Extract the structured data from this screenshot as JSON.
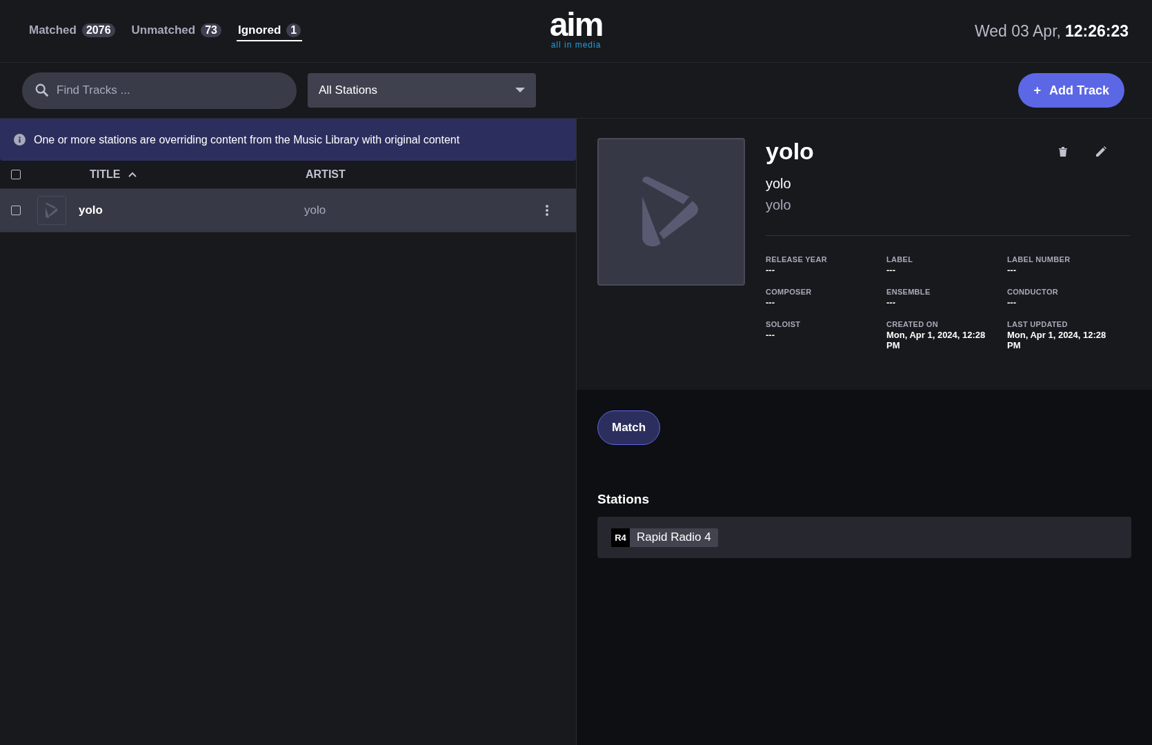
{
  "tabs": [
    {
      "label": "Matched",
      "count": "2076",
      "selected": false
    },
    {
      "label": "Unmatched",
      "count": "73",
      "selected": false
    },
    {
      "label": "Ignored",
      "count": "1",
      "selected": true
    }
  ],
  "logo": {
    "name": "aim",
    "tagline": "all in media"
  },
  "clock": {
    "date": "Wed 03 Apr,",
    "time": "12:26:23"
  },
  "search": {
    "placeholder": "Find Tracks ..."
  },
  "station_filter": {
    "value": "All Stations"
  },
  "add_button": {
    "icon": "+",
    "label": "Add Track"
  },
  "banner": {
    "text": "One or more stations are overriding content from the Music Library with original content"
  },
  "table": {
    "select_all": {
      "checked": false
    },
    "columns": [
      {
        "label": "TITLE",
        "sorted": true
      },
      {
        "label": "ARTIST",
        "sorted": false
      }
    ],
    "rows": [
      {
        "title": "yolo",
        "artist": "yolo",
        "checked": false,
        "selected": true
      }
    ]
  },
  "detail": {
    "title": "yolo",
    "subtitle": "yolo",
    "artist": "yolo",
    "fields": [
      {
        "label": "RELEASE YEAR",
        "value": "---"
      },
      {
        "label": "LABEL",
        "value": "---"
      },
      {
        "label": "LABEL NUMBER",
        "value": "---"
      },
      {
        "label": "COMPOSER",
        "value": "---"
      },
      {
        "label": "ENSEMBLE",
        "value": "---"
      },
      {
        "label": "CONDUCTOR",
        "value": "---"
      },
      {
        "label": "SOLOIST",
        "value": "---"
      },
      {
        "label": "CREATED ON",
        "value": "Mon, Apr 1, 2024, 12:28 PM"
      },
      {
        "label": "LAST UPDATED",
        "value": "Mon, Apr 1, 2024, 12:28 PM"
      }
    ]
  },
  "match_button": {
    "label": "Match"
  },
  "stations": {
    "heading": "Stations",
    "items": [
      {
        "badge": "R4",
        "name": "Rapid Radio 4"
      }
    ]
  }
}
